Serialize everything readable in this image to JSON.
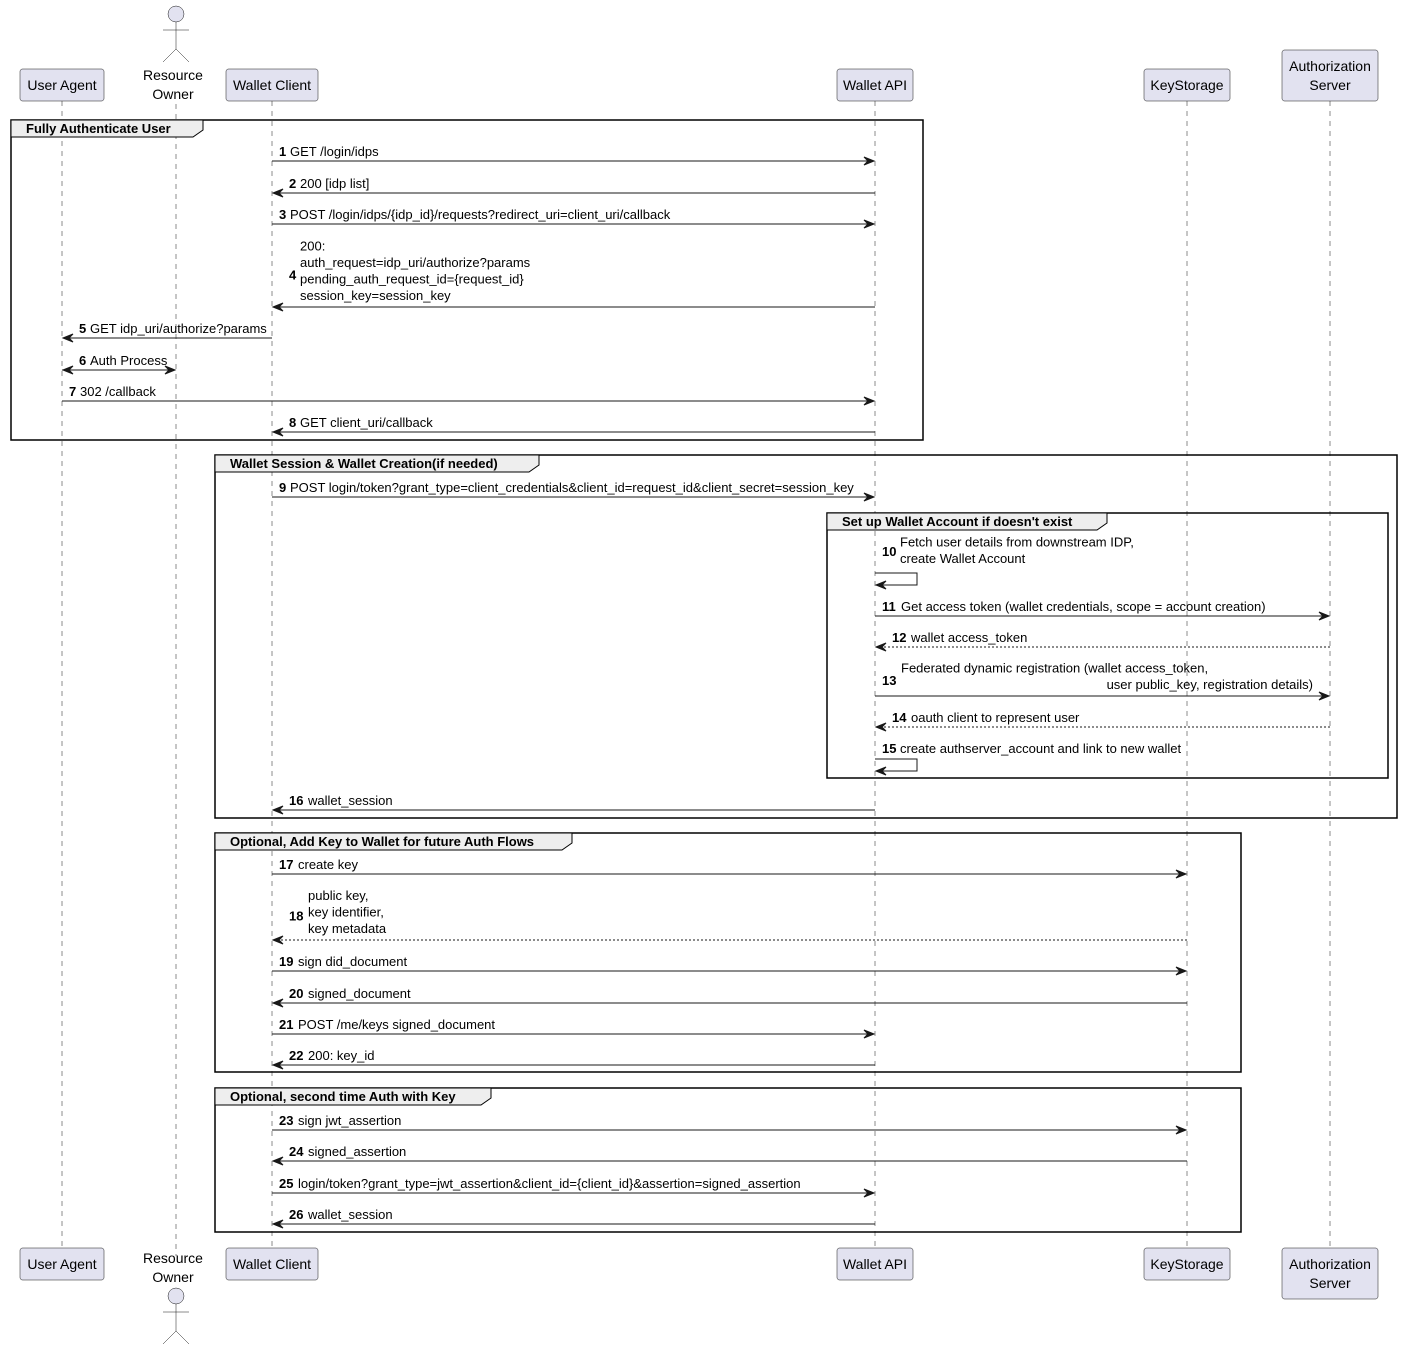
{
  "diagram_type": "sequence",
  "participants": [
    {
      "id": "ua",
      "label_lines": [
        "User Agent"
      ],
      "kind": "participant"
    },
    {
      "id": "ro",
      "label_lines": [
        "Resource",
        "Owner"
      ],
      "kind": "actor"
    },
    {
      "id": "wc",
      "label_lines": [
        "Wallet Client"
      ],
      "kind": "participant"
    },
    {
      "id": "api",
      "label_lines": [
        "Wallet API"
      ],
      "kind": "participant"
    },
    {
      "id": "ks",
      "label_lines": [
        "KeyStorage"
      ],
      "kind": "participant"
    },
    {
      "id": "as",
      "label_lines": [
        "Authorization",
        "Server"
      ],
      "kind": "participant"
    }
  ],
  "groups": [
    {
      "id": "g1",
      "label": "Fully Authenticate User"
    },
    {
      "id": "g2",
      "label": "Wallet Session & Wallet Creation(if needed)"
    },
    {
      "id": "g3",
      "label": "Set up Wallet Account if doesn't exist"
    },
    {
      "id": "g4",
      "label": "Optional, Add Key to Wallet for future Auth Flows"
    },
    {
      "id": "g5",
      "label": "Optional, second time Auth with Key"
    }
  ],
  "messages": [
    {
      "num": "1",
      "from": "wc",
      "to": "api",
      "style": "solid",
      "text_lines": [
        "GET /login/idps"
      ]
    },
    {
      "num": "2",
      "from": "api",
      "to": "wc",
      "style": "solid",
      "text_lines": [
        "200 [idp list]"
      ]
    },
    {
      "num": "3",
      "from": "wc",
      "to": "api",
      "style": "solid",
      "text_lines": [
        "POST /login/idps/{idp_id}/requests?redirect_uri=client_uri/callback"
      ]
    },
    {
      "num": "4",
      "from": "api",
      "to": "wc",
      "style": "solid",
      "text_lines": [
        "200:",
        "auth_request=idp_uri/authorize?params",
        "pending_auth_request_id={request_id}",
        "session_key=session_key"
      ]
    },
    {
      "num": "5",
      "from": "wc",
      "to": "ua",
      "style": "solid",
      "text_lines": [
        "GET idp_uri/authorize?params"
      ]
    },
    {
      "num": "6",
      "from": "ua",
      "to": "ro",
      "style": "bidirectional",
      "text_lines": [
        "Auth Process"
      ]
    },
    {
      "num": "7",
      "from": "ua",
      "to": "api",
      "style": "solid",
      "text_lines": [
        "302 /callback"
      ]
    },
    {
      "num": "8",
      "from": "api",
      "to": "wc",
      "style": "solid",
      "text_lines": [
        "GET client_uri/callback"
      ]
    },
    {
      "num": "9",
      "from": "wc",
      "to": "api",
      "style": "solid",
      "text_lines": [
        "POST login/token?grant_type=client_credentials&client_id=request_id&client_secret=session_key"
      ]
    },
    {
      "num": "10",
      "from": "api",
      "to": "api",
      "style": "self",
      "text_lines": [
        "Fetch user details from downstream IDP,",
        " create Wallet Account"
      ]
    },
    {
      "num": "11",
      "from": "api",
      "to": "as",
      "style": "solid",
      "text_lines": [
        "Get access token (wallet credentials, scope = account creation)"
      ]
    },
    {
      "num": "12",
      "from": "as",
      "to": "api",
      "style": "dashed",
      "text_lines": [
        "wallet access_token"
      ]
    },
    {
      "num": "13",
      "from": "api",
      "to": "as",
      "style": "solid",
      "text_lines": [
        "Federated dynamic registration (wallet access_token,",
        "user public_key, registration details)"
      ]
    },
    {
      "num": "14",
      "from": "as",
      "to": "api",
      "style": "dashed",
      "text_lines": [
        "oauth client to represent user"
      ]
    },
    {
      "num": "15",
      "from": "api",
      "to": "api",
      "style": "self",
      "text_lines": [
        "create authserver_account and link to new wallet"
      ]
    },
    {
      "num": "16",
      "from": "api",
      "to": "wc",
      "style": "solid",
      "text_lines": [
        "wallet_session"
      ]
    },
    {
      "num": "17",
      "from": "wc",
      "to": "ks",
      "style": "solid",
      "text_lines": [
        "create key"
      ]
    },
    {
      "num": "18",
      "from": "ks",
      "to": "wc",
      "style": "dashed",
      "text_lines": [
        "public key,",
        "key identifier,",
        "key metadata"
      ]
    },
    {
      "num": "19",
      "from": "wc",
      "to": "ks",
      "style": "solid",
      "text_lines": [
        "sign did_document"
      ]
    },
    {
      "num": "20",
      "from": "ks",
      "to": "wc",
      "style": "solid",
      "text_lines": [
        "signed_document"
      ]
    },
    {
      "num": "21",
      "from": "wc",
      "to": "api",
      "style": "solid",
      "text_lines": [
        "POST /me/keys signed_document"
      ]
    },
    {
      "num": "22",
      "from": "api",
      "to": "wc",
      "style": "solid",
      "text_lines": [
        "200: key_id"
      ]
    },
    {
      "num": "23",
      "from": "wc",
      "to": "ks",
      "style": "solid",
      "text_lines": [
        "sign jwt_assertion"
      ]
    },
    {
      "num": "24",
      "from": "ks",
      "to": "wc",
      "style": "solid",
      "text_lines": [
        "signed_assertion"
      ]
    },
    {
      "num": "25",
      "from": "wc",
      "to": "api",
      "style": "solid",
      "text_lines": [
        "login/token?grant_type=jwt_assertion&client_id={client_id}&assertion=signed_assertion"
      ]
    },
    {
      "num": "26",
      "from": "api",
      "to": "wc",
      "style": "solid",
      "text_lines": [
        "wallet_session"
      ]
    }
  ]
}
